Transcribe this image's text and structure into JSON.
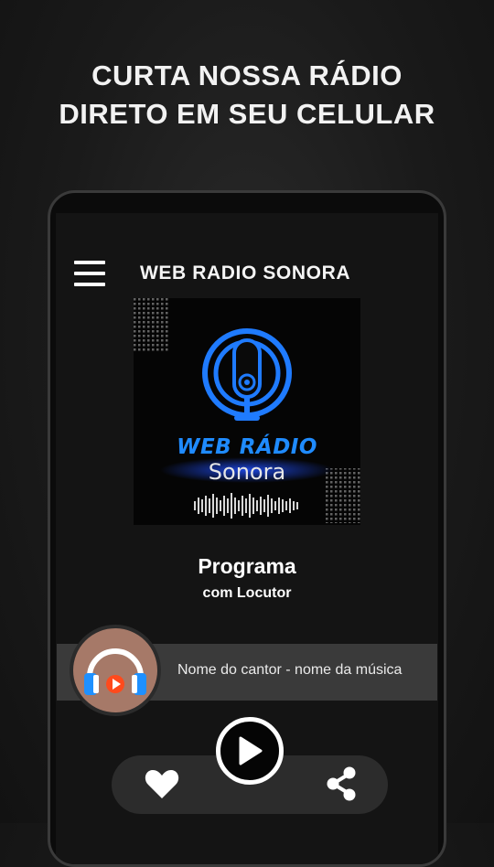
{
  "promo": {
    "line1": "CURTA NOSSA RÁDIO",
    "line2": "DIRETO EM SEU CELULAR"
  },
  "app": {
    "title": "WEB RADIO SONORA"
  },
  "logo": {
    "line1": "WEB RÁDIO",
    "line2": "Sonora",
    "accent": "#1f7bff"
  },
  "program": {
    "title": "Programa",
    "subtitle": "com Locutor"
  },
  "now_playing": {
    "text": "Nome do cantor - nome da música"
  },
  "controls": {
    "favorite_icon": "heart-icon",
    "play_icon": "play-icon",
    "share_icon": "share-icon"
  }
}
